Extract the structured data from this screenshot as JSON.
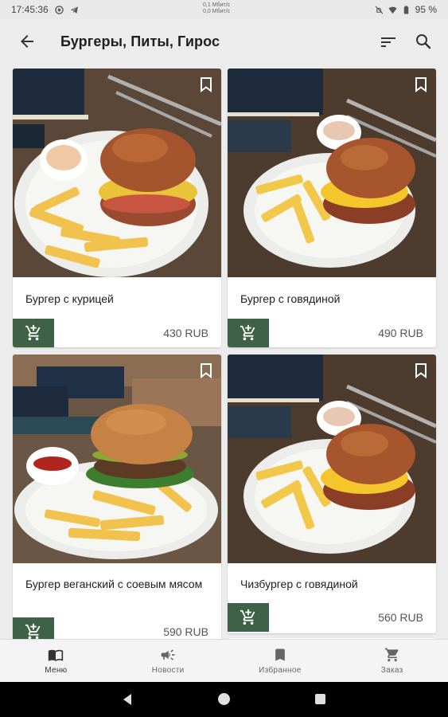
{
  "status_bar": {
    "time": "17:45:36",
    "network_up": "0,1 Мбит/с",
    "network_down": "0,0 Мбит/с",
    "battery": "95 %"
  },
  "app_bar": {
    "title": "Бургеры, Питы, Гирос",
    "icons": [
      "arrow-back-icon",
      "sort-icon",
      "search-icon"
    ]
  },
  "products": [
    {
      "name": "Бургер с курицей",
      "price": "430 RUB"
    },
    {
      "name": "Бургер с говядиной",
      "price": "490 RUB"
    },
    {
      "name": "Бургер веганский с соевым мясом",
      "price": "590 RUB"
    },
    {
      "name": "Чизбургер с говядиной",
      "price": "560 RUB"
    }
  ],
  "bottom_nav": [
    {
      "label": "Меню",
      "icon": "menu-book-icon",
      "active": true
    },
    {
      "label": "Новости",
      "icon": "megaphone-icon",
      "active": false
    },
    {
      "label": "Избранное",
      "icon": "bookmark-icon",
      "active": false
    },
    {
      "label": "Заказ",
      "icon": "cart-icon",
      "active": false
    }
  ],
  "colors": {
    "accent": "#3f6145",
    "background": "#ececec",
    "card": "#ffffff"
  }
}
